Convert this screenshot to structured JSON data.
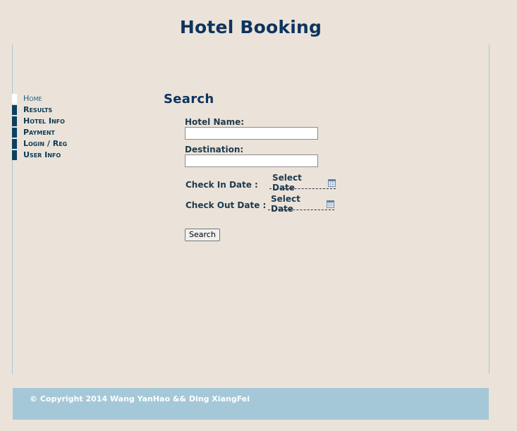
{
  "header": {
    "title": "Hotel Booking"
  },
  "nav": {
    "items": [
      {
        "label": "Home"
      },
      {
        "label": "Results"
      },
      {
        "label": "Hotel Info"
      },
      {
        "label": "Payment"
      },
      {
        "label": "Login / Reg"
      },
      {
        "label": "User Info"
      }
    ]
  },
  "search": {
    "heading": "Search",
    "hotel_name_label": "Hotel Name:",
    "hotel_name_value": "",
    "destination_label": "Destination:",
    "destination_value": "",
    "check_in_label": "Check In Date :",
    "check_in_value": "Select Date",
    "check_out_label": "Check Out Date :",
    "check_out_value": "Select Date",
    "button_label": "Search",
    "calendar_icon": "calendar-icon"
  },
  "footer": {
    "copyright": "© Copyright 2014 Wang YanHao && Ding XiangFei"
  },
  "colors": {
    "background": "#ebe3d9",
    "title": "#0d3460",
    "nav_marker": "#0d4060",
    "footer": "#a5c8d8"
  }
}
